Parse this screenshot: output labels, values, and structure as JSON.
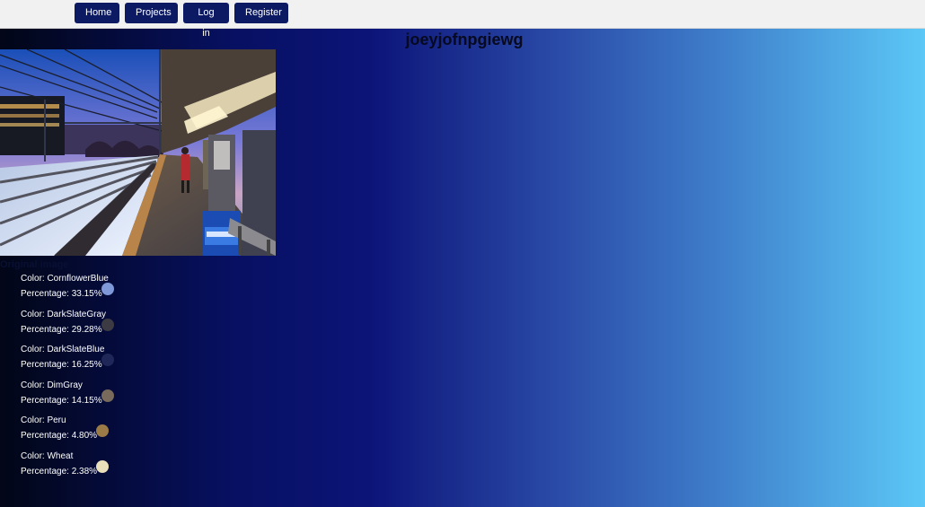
{
  "nav": {
    "home": "Home",
    "projects": "Projects",
    "login": "Log in",
    "register": "Register"
  },
  "page": {
    "title": "joeyjofnpgiewg",
    "photo_label": "Original image"
  },
  "colors": [
    {
      "color_label": "Color: CornflowerBlue",
      "percentage_label": "Percentage: 33.15%",
      "swatch": "#7f98d8"
    },
    {
      "color_label": "Color: DarkSlateGray",
      "percentage_label": "Percentage: 29.28%",
      "swatch": "#3c3a43"
    },
    {
      "color_label": "Color: DarkSlateBlue",
      "percentage_label": "Percentage: 16.25%",
      "swatch": "#1f2658"
    },
    {
      "color_label": "Color: DimGray",
      "percentage_label": "Percentage: 14.15%",
      "swatch": "#786b5b"
    },
    {
      "color_label": "Color: Peru",
      "percentage_label": "Percentage: 4.80%",
      "swatch": "#9a7a47"
    },
    {
      "color_label": "Color: Wheat",
      "percentage_label": "Percentage: 2.38%",
      "swatch": "#e9dfba"
    }
  ]
}
